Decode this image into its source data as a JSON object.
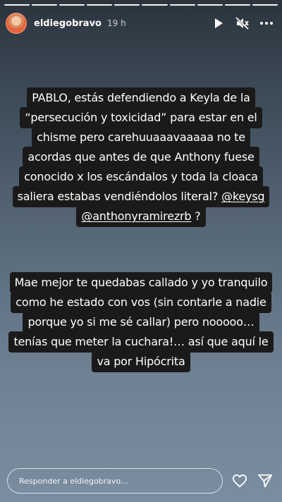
{
  "progress_segments": 10,
  "header": {
    "username": "eldiegobravo",
    "time": "19 h",
    "icons": [
      "play-icon",
      "muted-speaker-icon",
      "more-options-icon"
    ]
  },
  "story": {
    "paragraph1": [
      "PABLO, estás defendiendo a Keyla de la",
      "“persecución y toxicidad” para estar en el",
      "chisme pero carehuuaaavaaaaa no te",
      "acordas que antes de que Anthony fuese",
      "conocido x los escándalos y toda la cloaca",
      "saliera estabas vendiéndolos literal?"
    ],
    "mention1": "@keysg",
    "mention2": "@anthonyramirezrb",
    "line7_tail": " ?",
    "paragraph2": [
      "Mae mejor te quedabas callado y yo tranquilo",
      "como he estado con vos (sin contarle a nadie",
      "porque yo si me sé callar) pero nooooo…",
      "tenías que meter la cuchara!… así que aquí le",
      "va por Hipócrita"
    ]
  },
  "reply": {
    "placeholder": "Responder a eldiegobravo...",
    "icons": [
      "heart-icon",
      "send-icon"
    ]
  }
}
